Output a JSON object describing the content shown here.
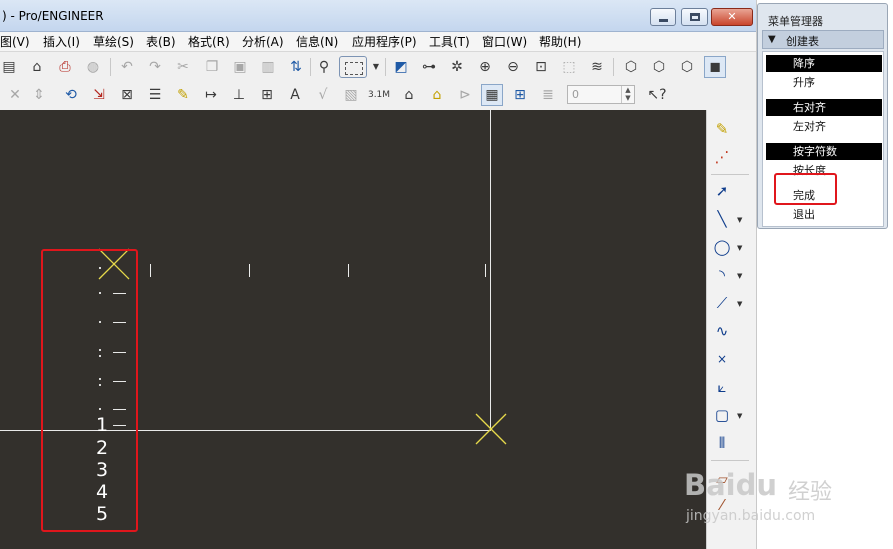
{
  "window": {
    "title": ") - Pro/ENGINEER",
    "min_glyph": "",
    "close_glyph": "✕"
  },
  "menubar": {
    "items": [
      "图(V)",
      "插入(I)",
      "草绘(S)",
      "表(B)",
      "格式(R)",
      "分析(A)",
      "信息(N)",
      "应用程序(P)",
      "工具(T)",
      "窗口(W)",
      "帮助(H)"
    ]
  },
  "toolbar": {
    "number_field_value": "0",
    "icons_row1": [
      "print-icon",
      "lock-icon",
      "pdf-icon",
      "undo-icon",
      "redo-icon",
      "cut-icon",
      "copy-icon",
      "paste-icon",
      "find-icon",
      "select-box-icon",
      "zoom-in-icon",
      "zoom-out-icon",
      "refit-icon",
      "layers-icon",
      "view-icon"
    ],
    "icons_row2": [
      "close-icon",
      "table-icon",
      "dimension-icon",
      "note-icon",
      "format-icon",
      "whats-this-icon"
    ]
  },
  "canvas": {
    "row_numbers": [
      "1",
      "2",
      "3",
      "4",
      "5"
    ],
    "colors": {
      "background": "#33302c",
      "lines": "#e9e9e9",
      "crosshair": "#e6d94a"
    }
  },
  "menu_manager": {
    "title": "菜单管理器",
    "section": "创建表",
    "items": [
      {
        "label": "降序",
        "selected": true
      },
      {
        "label": "升序",
        "selected": false
      },
      {
        "label": "右对齐",
        "selected": true
      },
      {
        "label": "左对齐",
        "selected": false
      },
      {
        "label": "按字符数",
        "selected": true
      },
      {
        "label": "按长度",
        "selected": false
      },
      {
        "label": "完成",
        "selected": false
      },
      {
        "label": "退出",
        "selected": false
      }
    ]
  },
  "watermark": {
    "brand": "Baidu",
    "cn": "经验",
    "url": "jingyan.baidu.com"
  }
}
